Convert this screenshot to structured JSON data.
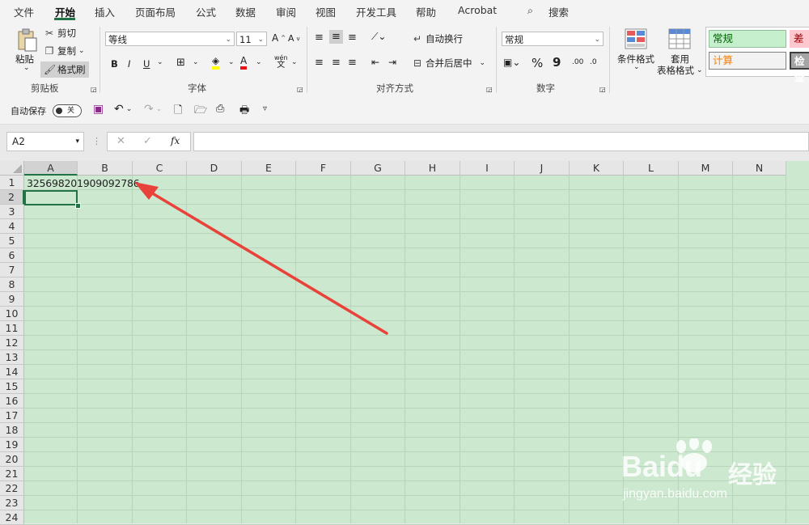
{
  "menu": {
    "tabs": [
      "文件",
      "开始",
      "插入",
      "页面布局",
      "公式",
      "数据",
      "审阅",
      "视图",
      "开发工具",
      "帮助",
      "Acrobat"
    ],
    "search": "搜索"
  },
  "ribbon": {
    "clipboard": {
      "paste": "粘贴",
      "cut": "剪切",
      "copy": "复制",
      "format_painter": "格式刷",
      "label": "剪贴板"
    },
    "font": {
      "name": "等线",
      "size": "11",
      "grow": "A",
      "shrink": "A",
      "bold": "B",
      "italic": "I",
      "underline": "U",
      "font_color": "A",
      "phonetic": "wén",
      "phonetic_char": "文",
      "label": "字体"
    },
    "alignment": {
      "wrap": "自动换行",
      "merge": "合并后居中",
      "label": "对齐方式"
    },
    "number": {
      "format": "常规",
      "percent": "%",
      "comma": "9",
      "inc_dec": ".00",
      "dec_dec": ".0",
      "label": "数字"
    },
    "styles": {
      "conditional": "条件格式",
      "table": "套用\n表格格式",
      "table_line1": "套用",
      "table_line2": "表格格式",
      "normal": "常规",
      "bad": "差",
      "calc": "计算",
      "check": "检查"
    }
  },
  "qat": {
    "autosave_label": "自动保存",
    "autosave_state": "关"
  },
  "formula_bar": {
    "name_box": "A2",
    "fx": "fx",
    "cancel": "✕",
    "enter": "✓",
    "value": ""
  },
  "sheet": {
    "columns": [
      "A",
      "B",
      "C",
      "D",
      "E",
      "F",
      "G",
      "H",
      "I",
      "J",
      "K",
      "L",
      "M",
      "N"
    ],
    "rows": [
      "1",
      "2",
      "3",
      "4",
      "5",
      "6",
      "7",
      "8",
      "9",
      "10",
      "11",
      "12",
      "13",
      "14",
      "15",
      "16",
      "17",
      "18",
      "19",
      "20",
      "21",
      "22",
      "23",
      "24"
    ],
    "cell_A1": "325698201909092786",
    "selected_cell": "A2"
  },
  "watermark": {
    "brand": "Baidu",
    "brand_cn": "经验",
    "url": "jingyan.baidu.com"
  },
  "colors": {
    "accent": "#217346",
    "grid_bg": "#cce8cf",
    "arrow": "#e8423a"
  }
}
